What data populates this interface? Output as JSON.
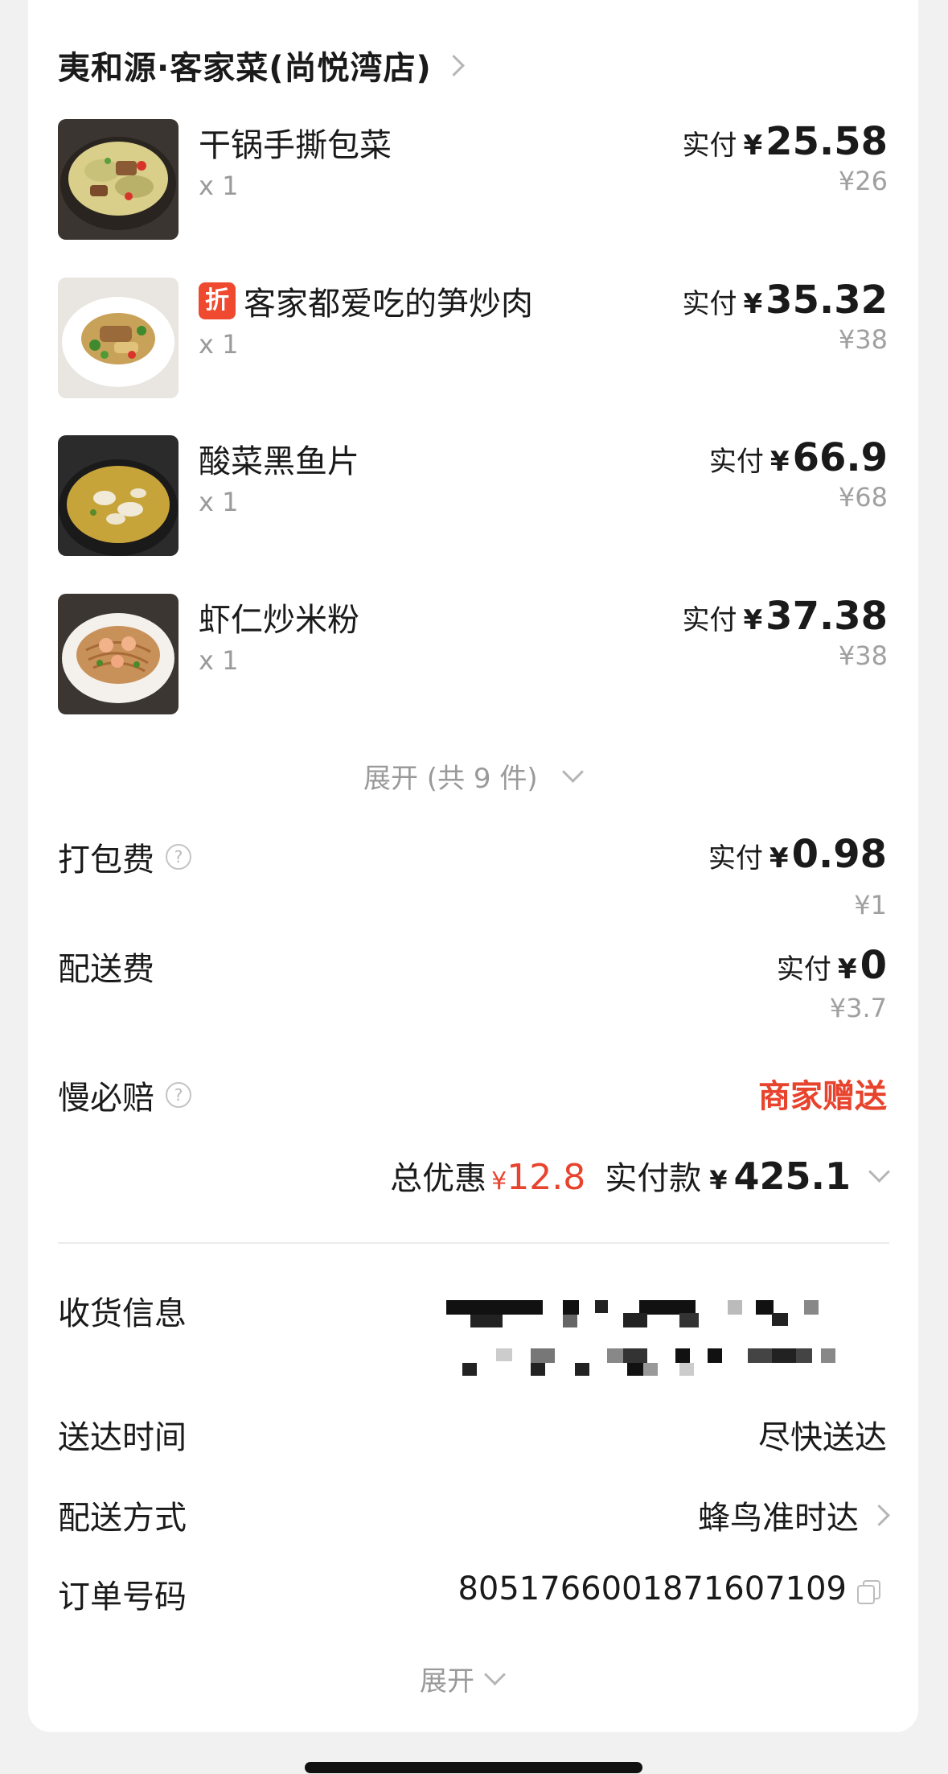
{
  "store": {
    "name": "夷和源·客家菜(尚悦湾店)"
  },
  "items": [
    {
      "name": "干锅手撕包菜",
      "qty": "x 1",
      "pay_label": "实付",
      "currency": "¥",
      "pay": "25.58",
      "original": "¥26",
      "discount_tag": ""
    },
    {
      "name": "客家都爱吃的笋炒肉",
      "qty": "x 1",
      "pay_label": "实付",
      "currency": "¥",
      "pay": "35.32",
      "original": "¥38",
      "discount_tag": "折"
    },
    {
      "name": "酸菜黑鱼片",
      "qty": "x 1",
      "pay_label": "实付",
      "currency": "¥",
      "pay": "66.9",
      "original": "¥68",
      "discount_tag": ""
    },
    {
      "name": "虾仁炒米粉",
      "qty": "x 1",
      "pay_label": "实付",
      "currency": "¥",
      "pay": "37.38",
      "original": "¥38",
      "discount_tag": ""
    }
  ],
  "expand_items": {
    "label": "展开 (共 9 件)"
  },
  "fees": {
    "packing": {
      "label": "打包费",
      "pay_label": "实付",
      "currency": "¥",
      "pay": "0.98",
      "original": "¥1"
    },
    "delivery": {
      "label": "配送费",
      "pay_label": "实付",
      "currency": "¥",
      "pay": "0",
      "original": "¥3.7"
    },
    "late": {
      "label": "慢必赔",
      "value": "商家赠送"
    }
  },
  "summary": {
    "discount_label": "总优惠",
    "discount_currency": "¥",
    "discount_value": "12.8",
    "total_label": "实付款",
    "total_currency": "¥",
    "total_value": "425.1"
  },
  "info": {
    "address_label": "收货信息",
    "time_label": "送达时间",
    "time_value": "尽快送达",
    "method_label": "配送方式",
    "method_value": "蜂鸟准时达",
    "order_label": "订单号码",
    "order_value": "8051766001871607109"
  },
  "expand_more": {
    "label": "展开"
  },
  "icons": {
    "store_chevron": "chevron-right-icon",
    "help": "help-circle-icon",
    "copy": "copy-icon",
    "expand": "chevron-down-icon"
  },
  "colors": {
    "accent_red": "#e8432d",
    "discount_tag_bg": "#ef4a2f",
    "muted_text": "#9a9a9a"
  }
}
